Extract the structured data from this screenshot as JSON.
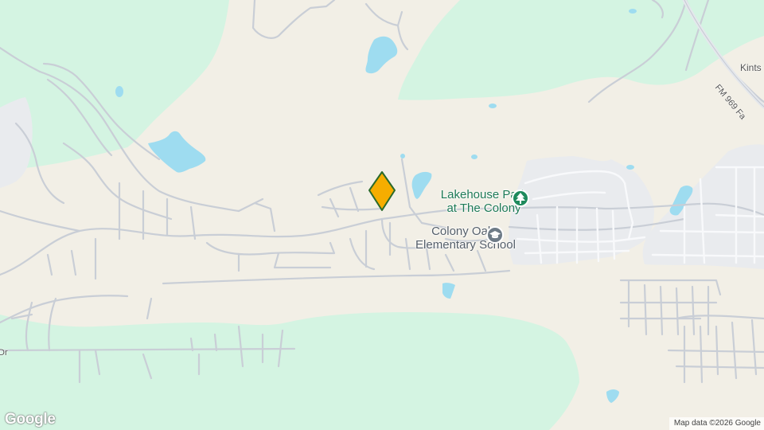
{
  "map": {
    "colors": {
      "land": "#f2efe6",
      "park": "#d4f4e2",
      "water": "#9edcf0",
      "urban": "#e9ebee",
      "road": "#c9ced6",
      "marker_fill": "#f6ad00",
      "marker_stroke": "#2b6a2b"
    },
    "pois": {
      "park": {
        "name_line1": "Lakehouse Park",
        "name_line2": "at The Colony",
        "icon": "tree-icon"
      },
      "school": {
        "name_line1": "Colony Oaks",
        "name_line2": "Elementary School",
        "icon": "graduation-cap-icon"
      }
    },
    "roads": {
      "fm": "FM 969 Fa",
      "kints": "Kints",
      "dr": "Dr"
    },
    "marker": {
      "icon": "location-pin-icon"
    },
    "branding": {
      "logo": "Google",
      "attribution": "Map data ©2026 Google"
    }
  }
}
